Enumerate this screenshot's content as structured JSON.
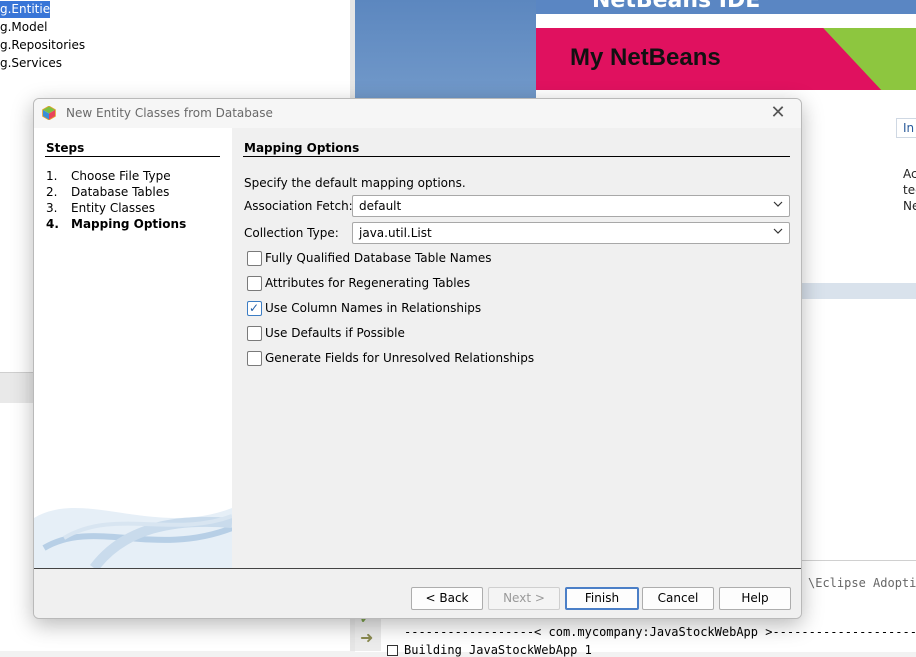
{
  "project_tree": {
    "items": [
      {
        "label": "g.Entities",
        "selected": true
      },
      {
        "label": "g.Model"
      },
      {
        "label": "g.Repositories"
      },
      {
        "label": "g.Services"
      }
    ]
  },
  "welcome": {
    "header_text": "NetBeans IDE",
    "banner_title": "My NetBeans",
    "tab_label": "In",
    "snippets": [
      "Ac",
      "tec",
      "Ne"
    ]
  },
  "output": {
    "line1": "\\Eclipse Adoptiu",
    "line2": "------------------< com.mycompany:JavaStockWebApp >--------------------",
    "line3": "Building JavaStockWebApp 1"
  },
  "dialog": {
    "title": "New Entity Classes from Database",
    "close_glyph": "✕",
    "steps": {
      "heading": "Steps",
      "items": [
        {
          "num": "1.",
          "label": "Choose File Type"
        },
        {
          "num": "2.",
          "label": "Database Tables"
        },
        {
          "num": "3.",
          "label": "Entity Classes"
        },
        {
          "num": "4.",
          "label": "Mapping Options",
          "current": true
        }
      ]
    },
    "content": {
      "heading": "Mapping Options",
      "description": "Specify the default mapping options.",
      "association_fetch": {
        "label": "Association Fetch:",
        "value": "default"
      },
      "collection_type": {
        "label": "Collection Type:",
        "value": "java.util.List"
      },
      "checkboxes": [
        {
          "label": "Fully Qualified Database Table Names",
          "checked": false
        },
        {
          "label": "Attributes for Regenerating Tables",
          "checked": false
        },
        {
          "label": "Use Column Names in Relationships",
          "checked": true
        },
        {
          "label": "Use Defaults if Possible",
          "checked": false
        },
        {
          "label": "Generate Fields for Unresolved Relationships",
          "checked": false
        }
      ]
    },
    "buttons": {
      "back": "< Back",
      "next": "Next >",
      "finish": "Finish",
      "cancel": "Cancel",
      "help": "Help"
    }
  }
}
